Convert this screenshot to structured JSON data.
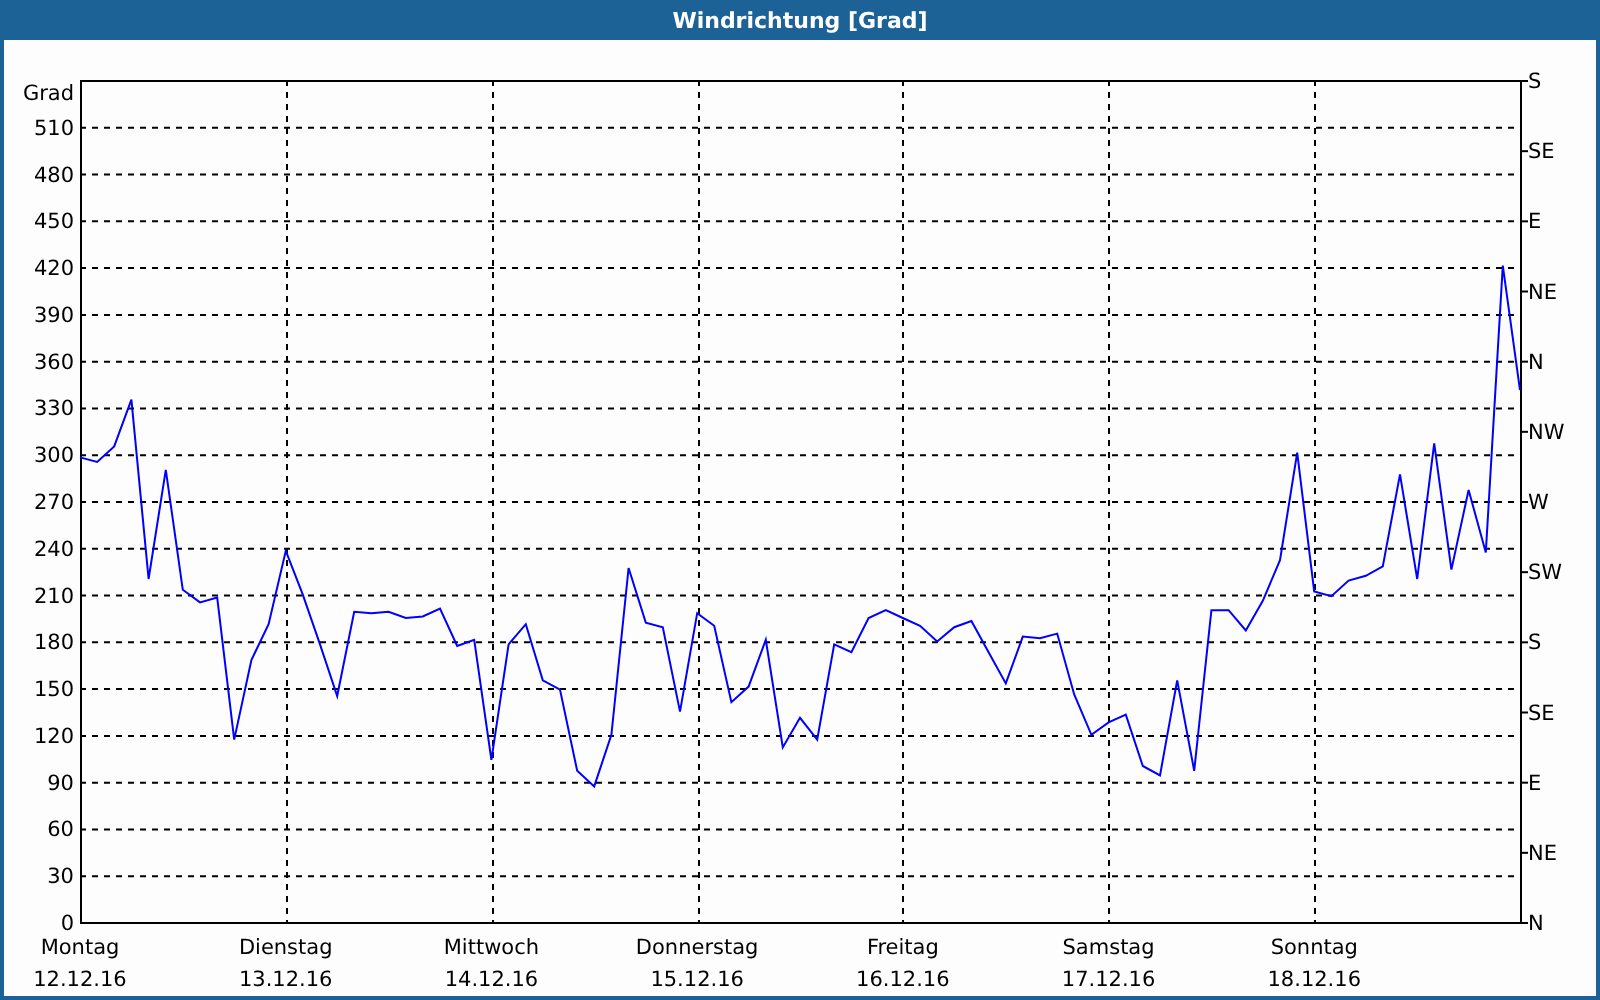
{
  "window": {
    "title": "Windrichtung [Grad]"
  },
  "chart": {
    "compass_labels": [
      "S",
      "SE",
      "E",
      "NE",
      "N",
      "NW",
      "W",
      "SW",
      "S",
      "SE",
      "E",
      "NE",
      "N"
    ],
    "chart_data": {
      "type": "line",
      "grid": true,
      "ylabel": "Grad",
      "ylim": [
        0,
        540
      ],
      "yticks": [
        0,
        30,
        60,
        90,
        120,
        150,
        180,
        210,
        240,
        270,
        300,
        330,
        360,
        390,
        420,
        450,
        480,
        510
      ],
      "categories": [
        "Montag 12.12.16",
        null,
        null,
        null,
        null,
        null,
        null,
        null,
        null,
        null,
        null,
        null,
        "Dienstag 13.12.16",
        null,
        null,
        null,
        null,
        null,
        null,
        null,
        null,
        null,
        null,
        null,
        "Mittwoch 14.12.16",
        null,
        null,
        null,
        null,
        null,
        null,
        null,
        null,
        null,
        null,
        null,
        "Donnerstag 15.12.16",
        null,
        null,
        null,
        null,
        null,
        null,
        null,
        null,
        null,
        null,
        null,
        "Freitag 16.12.16",
        null,
        null,
        null,
        null,
        null,
        null,
        null,
        null,
        null,
        null,
        null,
        "Samstag 17.12.16",
        null,
        null,
        null,
        null,
        null,
        null,
        null,
        null,
        null,
        null,
        null,
        "Sonntag 18.12.16",
        null,
        null,
        null,
        null,
        null,
        null,
        null,
        null,
        null,
        null,
        null,
        null
      ],
      "series": [
        {
          "color": "#0000ff",
          "values": [
            298,
            295,
            305,
            335,
            220,
            290,
            213,
            205,
            208,
            117,
            168,
            191,
            238,
            210,
            178,
            145,
            199,
            198,
            199,
            195,
            196,
            201,
            177,
            181,
            104,
            178,
            191,
            155,
            149,
            97,
            87,
            120,
            227,
            192,
            189,
            135,
            198,
            190,
            141,
            151,
            181,
            112,
            131,
            117,
            178,
            173,
            195,
            200,
            195,
            190,
            180,
            189,
            193,
            173,
            153,
            183,
            182,
            185,
            146,
            120,
            128,
            133,
            100,
            94,
            155,
            97,
            200,
            200,
            187,
            206,
            232,
            301,
            212,
            209,
            219,
            222,
            228,
            287,
            220,
            307,
            226,
            277,
            237,
            421,
            341
          ]
        }
      ]
    }
  }
}
